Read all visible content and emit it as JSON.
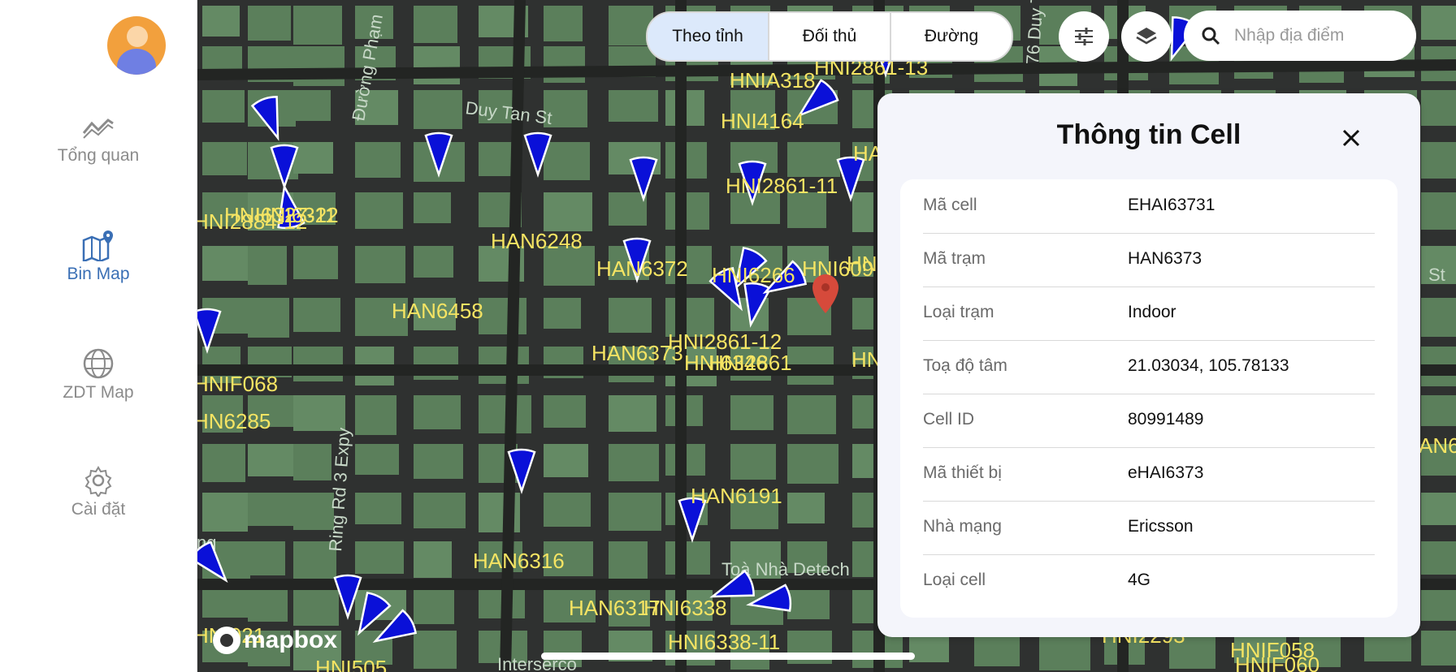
{
  "sidebar": {
    "items": [
      {
        "label": "Tổng quan",
        "icon": "trend-icon"
      },
      {
        "label": "Bin Map",
        "icon": "map-pin-icon"
      },
      {
        "label": "ZDT Map",
        "icon": "globe-icon"
      },
      {
        "label": "Cài đặt",
        "icon": "gear-icon"
      }
    ]
  },
  "topbar": {
    "tabs": [
      "Theo tỉnh",
      "Đối thủ",
      "Đường"
    ],
    "active_tab": "Theo tỉnh",
    "search_placeholder": "Nhập địa điểm"
  },
  "map": {
    "streets": [
      "Đường Phạm",
      "Duy Tan St",
      "Ring Rd 3 Expy",
      "Toà Nhà Detech",
      "Interserco",
      "76 Duy T",
      "St",
      "ng"
    ],
    "attribution": "mapbox",
    "cell_labels": [
      "HNI2861-13",
      "HNIA318",
      "HNI4164",
      "HNI2884-12",
      "HNI6327-11",
      "HNI6322",
      "HAN6248",
      "HNI2861-11",
      "HAN6372",
      "HNI6266",
      "HNI609",
      "HAN6458",
      "HNI2861-12",
      "HAN6373",
      "HNI6346",
      "HNI2861",
      "HNIF068",
      "HN6285",
      "HAN6191",
      "HAN6316",
      "HAN6317",
      "HNI6338",
      "HNI6338-11",
      "HNI021",
      "HNI505",
      "HNI2293",
      "HNIF058",
      "HNIF060",
      "HA",
      "HN",
      "HN",
      "AN6"
    ]
  },
  "panel": {
    "title": "Thông tin Cell",
    "rows": [
      {
        "label": "Mã cell",
        "value": "EHAI63731"
      },
      {
        "label": "Mã trạm",
        "value": "HAN6373"
      },
      {
        "label": "Loại trạm",
        "value": "Indoor"
      },
      {
        "label": "Toạ độ tâm",
        "value": "21.03034, 105.78133"
      },
      {
        "label": "Cell ID",
        "value": "80991489"
      },
      {
        "label": "Mã thiết bị",
        "value": "eHAI6373"
      },
      {
        "label": "Nhà mạng",
        "value": "Ericsson"
      },
      {
        "label": "Loại cell",
        "value": "4G"
      }
    ]
  },
  "colors": {
    "accent": "#3a6fb5",
    "map_green": "#5b7f5b",
    "sector_blue": "#0a10d8",
    "label_yellow": "#f5e463",
    "pin_red": "#d64a3b"
  }
}
